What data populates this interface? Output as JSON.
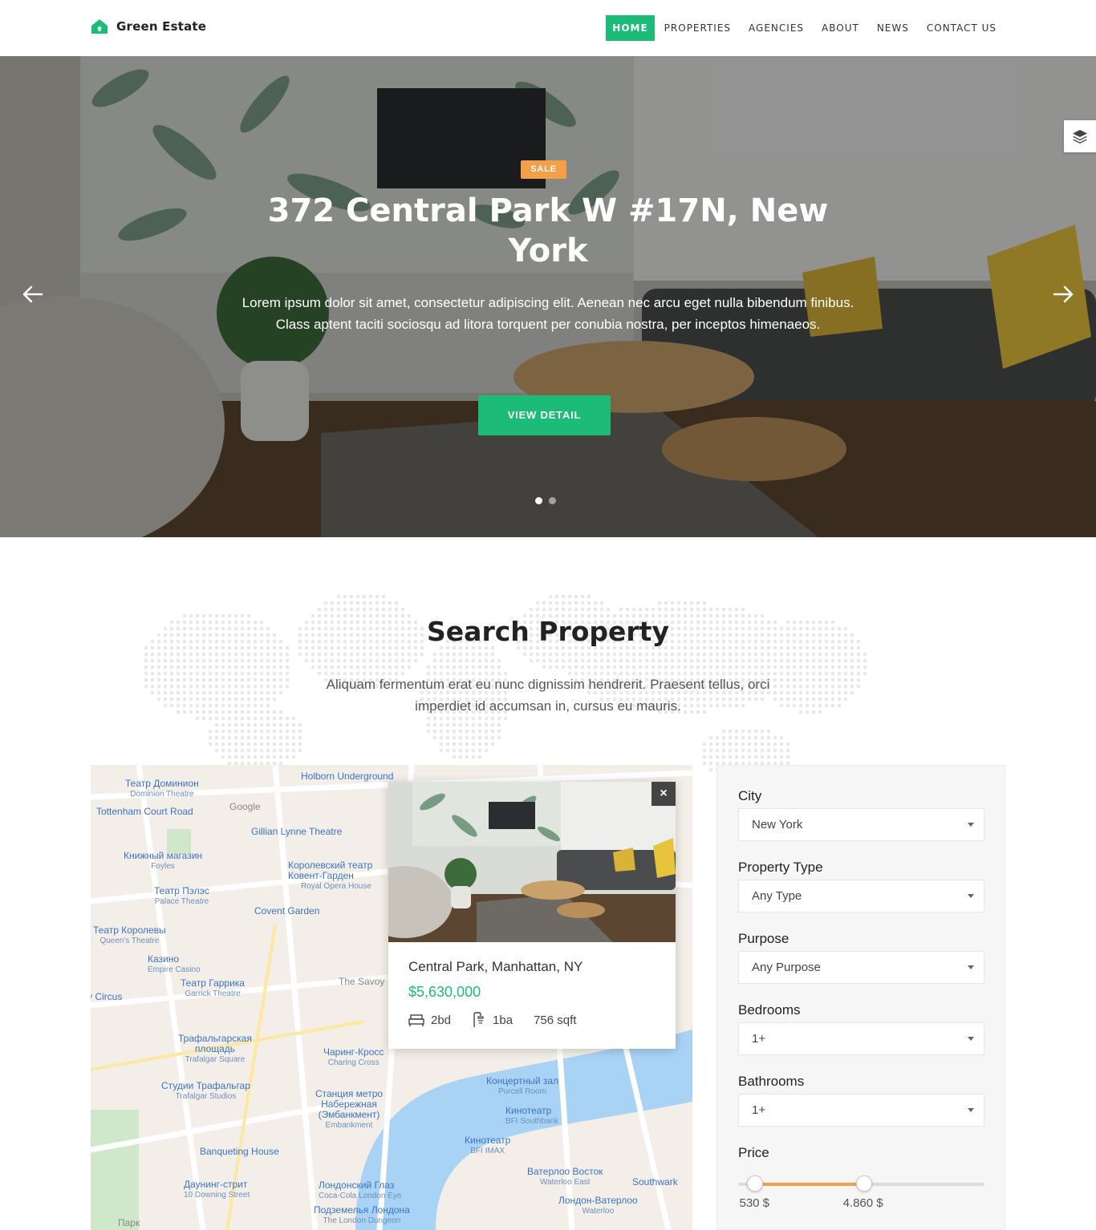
{
  "header": {
    "brand": "Green Estate",
    "nav": [
      "HOME",
      "PROPERTIES",
      "AGENCIES",
      "ABOUT",
      "NEWS",
      "CONTACT US"
    ],
    "accent": "#1cbc78"
  },
  "hero": {
    "badge": "SALE",
    "title": "372 Central Park W #17N, New York",
    "description": "Lorem ipsum dolor sit amet, consectetur adipiscing elit. Aenean nec arcu eget nulla bibendum finibus. Class aptent taciti sociosqu ad litora torquent per conubia nostra, per inceptos himenaeos.",
    "button": "VIEW DETAIL",
    "badge_color": "#f5a048",
    "slides": 2,
    "active_slide": 1
  },
  "search": {
    "title": "Search Property",
    "description": "Aliquam fermentum erat eu nunc dignissim hendrerit. Praesent tellus, orci imperdiet id accumsan in, cursus eu mauris."
  },
  "map": {
    "labels": [
      {
        "main": "Театр Доминион",
        "sub": "Dominion Theatre"
      },
      {
        "main": "Holborn Underground",
        "sub": ""
      },
      {
        "main": "Tottenham Court Road",
        "sub": ""
      },
      {
        "main": "Google",
        "sub": ""
      },
      {
        "main": "Gillian Lynne Theatre",
        "sub": ""
      },
      {
        "main": "Книжный магазин",
        "sub": "Foyles"
      },
      {
        "main": "Королевский театр Ковент-Гарден",
        "sub": "Royal Opera House"
      },
      {
        "main": "Театр Пэлэс",
        "sub": "Palace Theatre"
      },
      {
        "main": "Covent Garden",
        "sub": ""
      },
      {
        "main": "Театр Королевы",
        "sub": "Queen's Theatre"
      },
      {
        "main": "Казино",
        "sub": "Empire Casino"
      },
      {
        "main": "Театр Гаррика",
        "sub": "Garrick Theatre"
      },
      {
        "main": "The Savoy",
        "sub": ""
      },
      {
        "main": "Piccadilly Circus",
        "sub": ""
      },
      {
        "main": "Трафальгарская площадь",
        "sub": "Trafalgar Square"
      },
      {
        "main": "Чаринг-Кросс",
        "sub": "Charing Cross"
      },
      {
        "main": "Концертный зал",
        "sub": "Purcell Room"
      },
      {
        "main": "Студии Трафальгар",
        "sub": "Trafalgar Studios"
      },
      {
        "main": "Станция метро Набережная (Эмбанкмент)",
        "sub": "Embankment"
      },
      {
        "main": "Кинотеатр",
        "sub": "BFI Southbank"
      },
      {
        "main": "Кинотеатр",
        "sub": "BFI IMAX"
      },
      {
        "main": "Banqueting House",
        "sub": ""
      },
      {
        "main": "Ватерлоо Восток",
        "sub": "Waterloo East"
      },
      {
        "main": "Southwark",
        "sub": ""
      },
      {
        "main": "Даунинг-стрит",
        "sub": "10 Downing Street"
      },
      {
        "main": "Лондонский Глаз",
        "sub": "Coca-Cola London Eye"
      },
      {
        "main": "Лондон-Ватерлоо",
        "sub": "Waterloo"
      },
      {
        "main": "Подземелья Лондона",
        "sub": "The London Dungeon"
      },
      {
        "main": "Парк",
        "sub": ""
      }
    ],
    "popup": {
      "title": "Central Park, Manhattan, NY",
      "price": "$5,630,000",
      "beds": "2bd",
      "baths": "1ba",
      "area": "756 sqft",
      "close": "×"
    }
  },
  "filter": {
    "fields": [
      {
        "label": "City",
        "value": "New York"
      },
      {
        "label": "Property Type",
        "value": "Any Type"
      },
      {
        "label": "Purpose",
        "value": "Any Purpose"
      },
      {
        "label": "Bedrooms",
        "value": "1+"
      },
      {
        "label": "Bathrooms",
        "value": "1+"
      }
    ],
    "price": {
      "label": "Price",
      "min_label": "530 $",
      "max_label": "4.860 $",
      "low_fraction": 0.07,
      "high_fraction": 0.51,
      "fill_color": "#f5a048"
    }
  }
}
